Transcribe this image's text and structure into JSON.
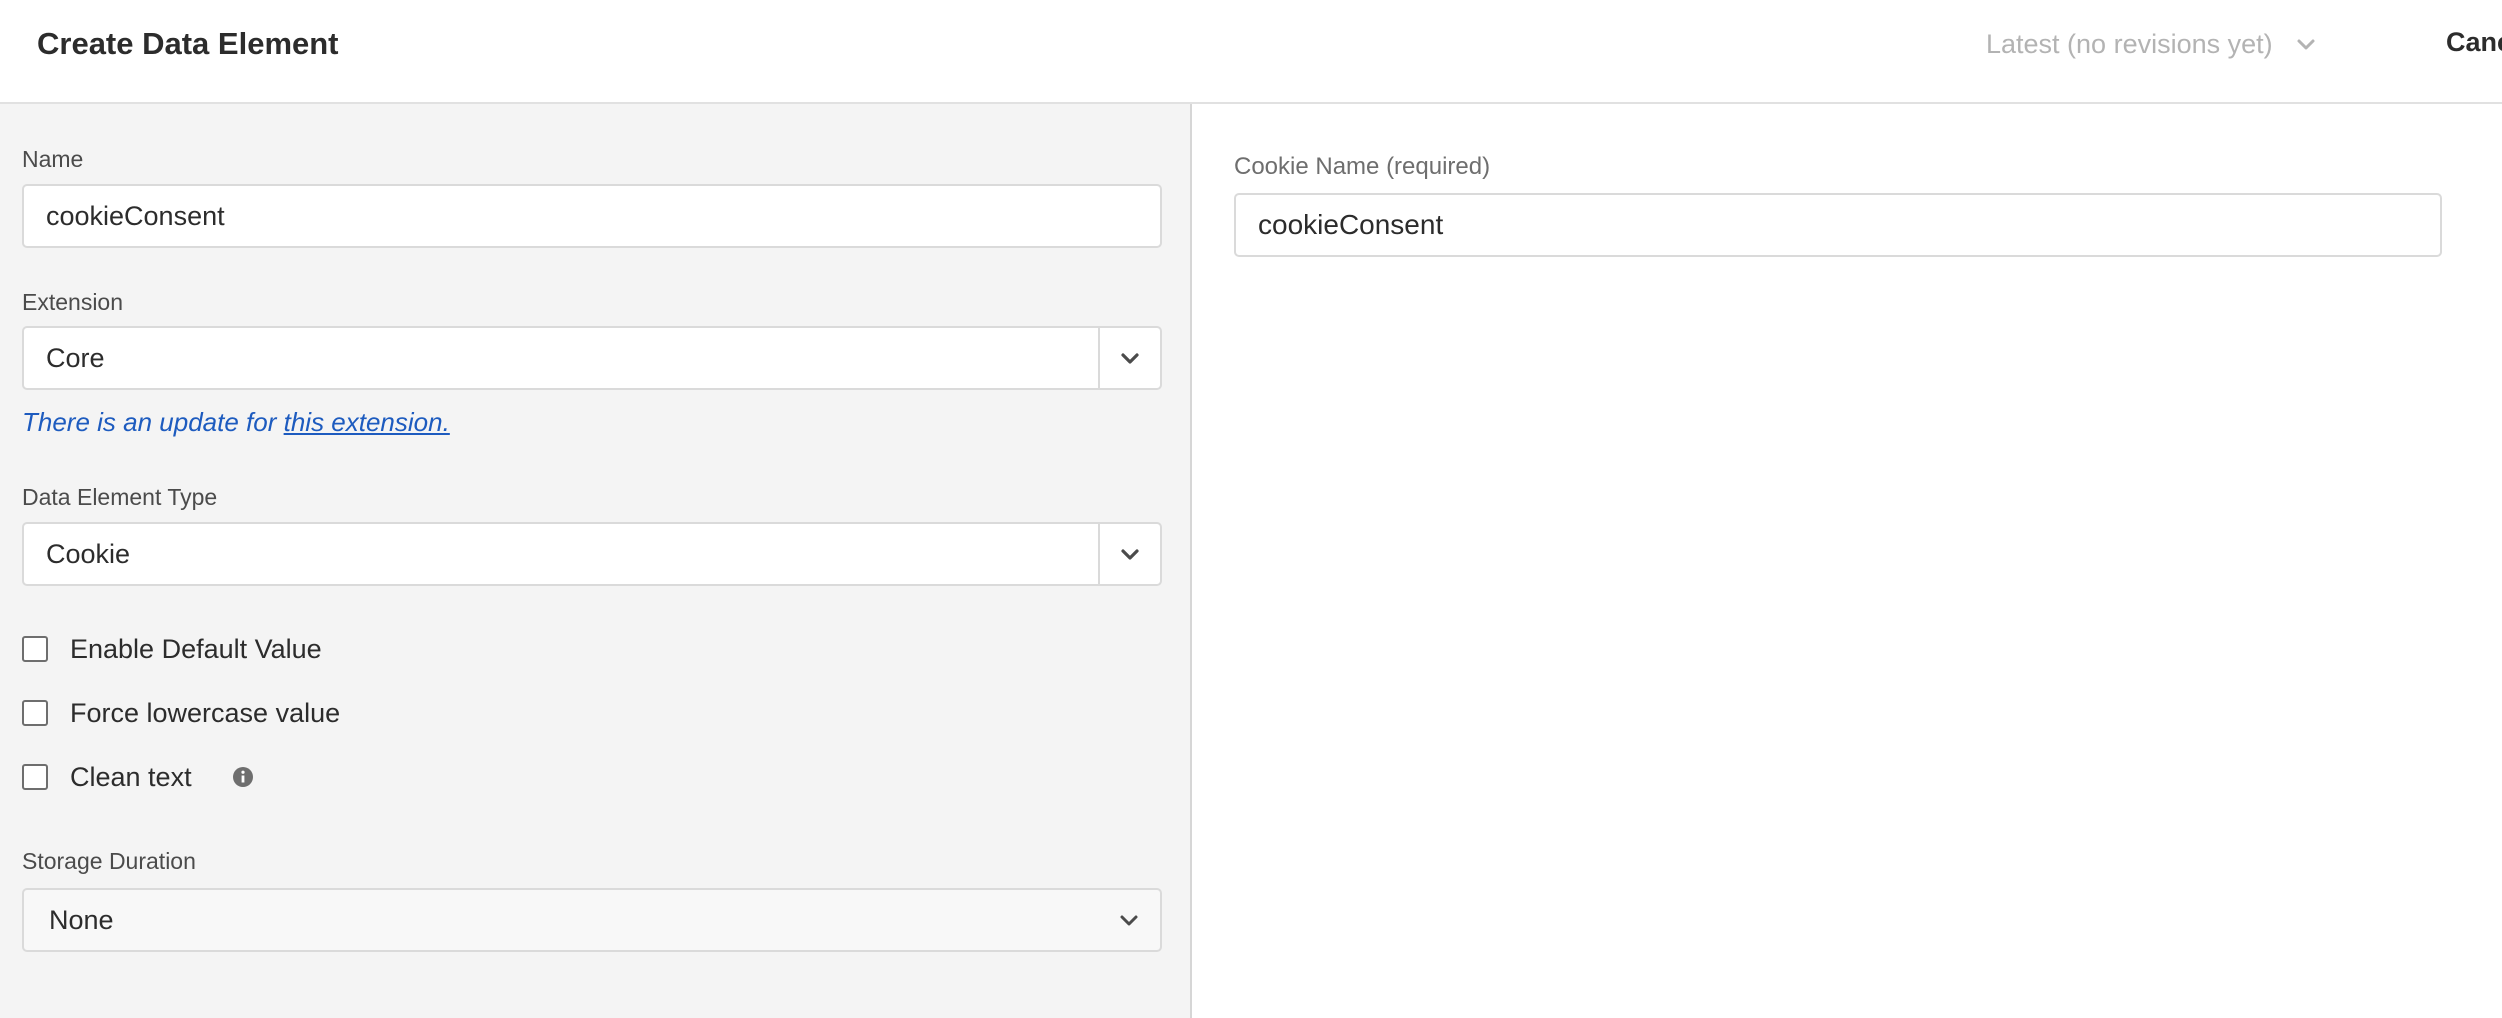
{
  "header": {
    "title": "Create Data Element",
    "revision_label": "Latest (no revisions yet)",
    "cancel_label": "Cancel"
  },
  "form": {
    "name": {
      "label": "Name",
      "value": "cookieConsent"
    },
    "extension": {
      "label": "Extension",
      "selected": "Core",
      "update_text": "There is an update for ",
      "update_link": "this extension."
    },
    "type": {
      "label": "Data Element Type",
      "selected": "Cookie"
    },
    "checkboxes": [
      {
        "label": "Enable Default Value",
        "checked": false
      },
      {
        "label": "Force lowercase value",
        "checked": false
      },
      {
        "label": "Clean text",
        "checked": false,
        "icon": "info-icon"
      }
    ],
    "storage": {
      "label": "Storage Duration",
      "selected": "None"
    }
  },
  "settings": {
    "cookie_name": {
      "label": "Cookie Name (required)",
      "value": "cookieConsent"
    }
  },
  "colors": {
    "link": "#1d5bbf",
    "panel_background": "#f4f4f4",
    "muted_text": "#b3b3b3"
  }
}
